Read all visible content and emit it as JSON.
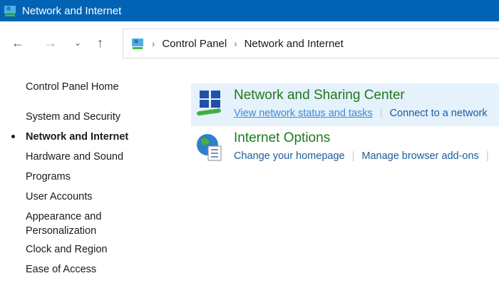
{
  "window": {
    "title": "Network and Internet"
  },
  "address": {
    "crumbs": [
      "Control Panel",
      "Network and Internet"
    ]
  },
  "sidebar": {
    "items": [
      {
        "label": "Control Panel Home"
      },
      {
        "label": "System and Security"
      },
      {
        "label": "Network and Internet",
        "active": true
      },
      {
        "label": "Hardware and Sound"
      },
      {
        "label": "Programs"
      },
      {
        "label": "User Accounts"
      },
      {
        "label": "Appearance and"
      },
      {
        "label": "Personalization"
      },
      {
        "label": "Clock and Region"
      },
      {
        "label": "Ease of Access"
      }
    ]
  },
  "categories": [
    {
      "title": "Network and Sharing Center",
      "links": [
        "View network status and tasks",
        "Connect to a network"
      ]
    },
    {
      "title": "Internet Options",
      "links": [
        "Change your homepage",
        "Manage browser add-ons"
      ]
    }
  ]
}
